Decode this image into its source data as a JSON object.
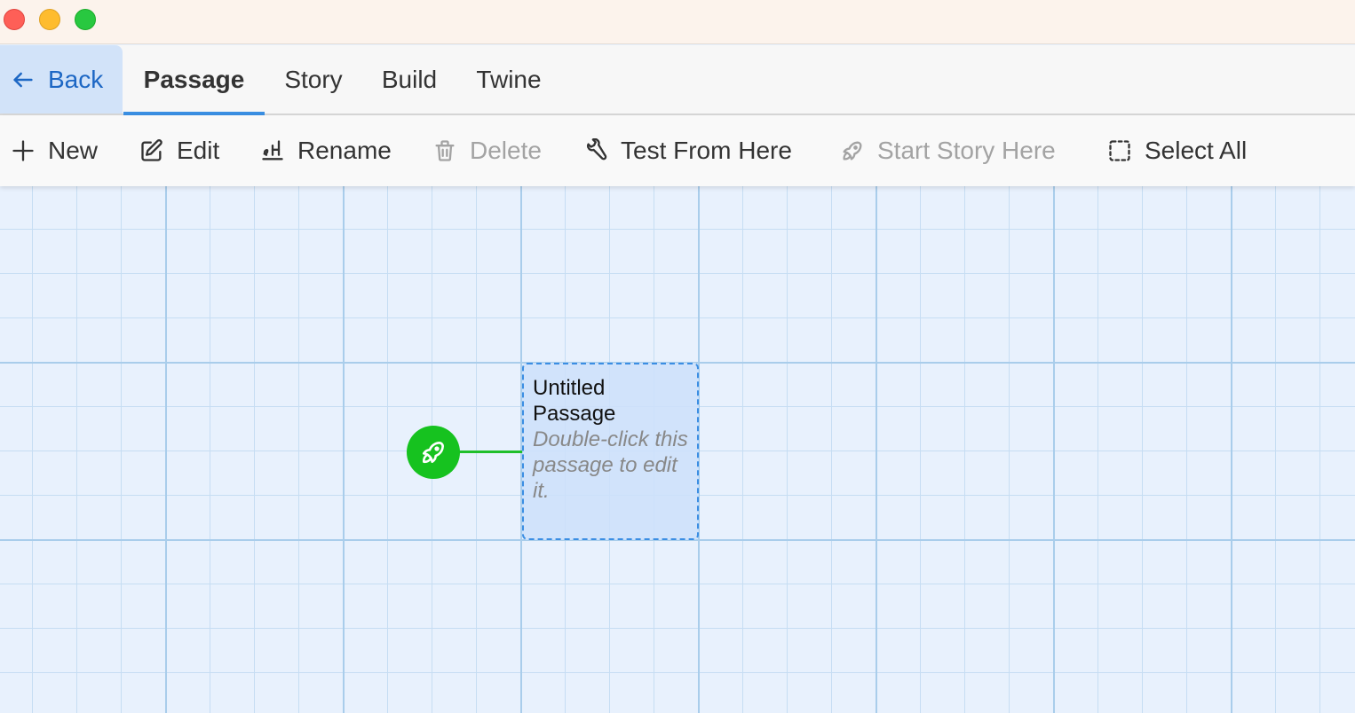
{
  "window": {
    "controls": [
      "close",
      "minimize",
      "zoom"
    ]
  },
  "tabs": {
    "back_label": "Back",
    "items": [
      {
        "label": "Passage",
        "active": true
      },
      {
        "label": "Story",
        "active": false
      },
      {
        "label": "Build",
        "active": false
      },
      {
        "label": "Twine",
        "active": false
      }
    ]
  },
  "toolbar": {
    "new_label": "New",
    "edit_label": "Edit",
    "rename_label": "Rename",
    "delete_label": "Delete",
    "test_from_here_label": "Test From Here",
    "start_story_here_label": "Start Story Here",
    "select_all_label": "Select All"
  },
  "canvas": {
    "passage": {
      "title": "Untitled Passage",
      "excerpt": "Double-click this passage to edit it."
    },
    "start_marker_icon": "rocket-icon"
  },
  "colors": {
    "accent": "#3a8fe3",
    "back_bg": "#d2e3f9",
    "start_green": "#16c21f",
    "canvas_bg": "#e8f1fd"
  }
}
